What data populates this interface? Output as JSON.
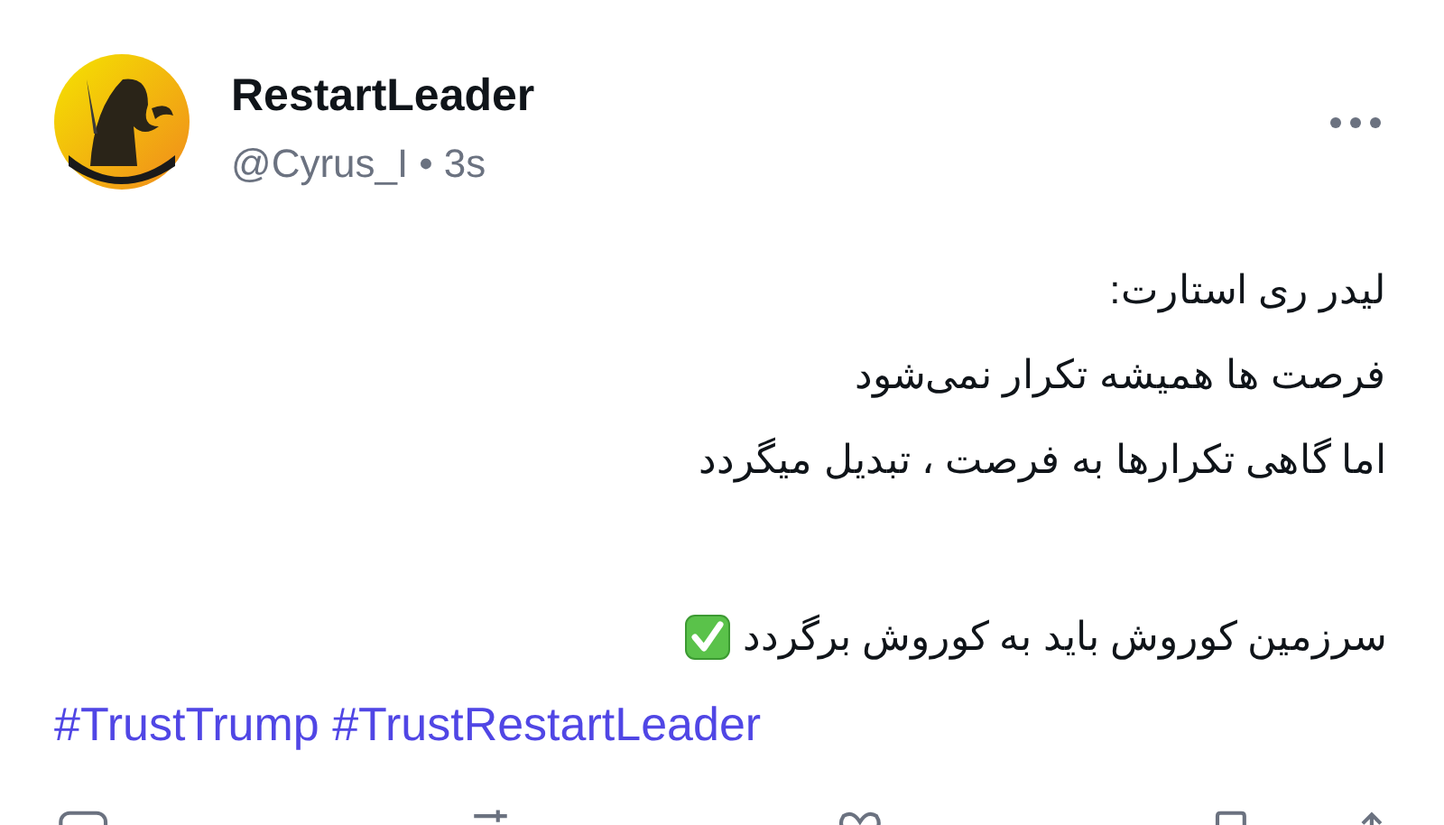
{
  "post": {
    "author": {
      "name": "RestartLeader",
      "handle": "@Cyrus_I",
      "separator": "•",
      "time": "3s"
    },
    "paragraphs": [
      [
        {
          "kind": "plain",
          "text": "لیدر ری استارت:"
        },
        {
          "kind": "plain",
          "text": "فرصت ها همیشه تکرار نمی‌شود"
        },
        {
          "kind": "plain",
          "text": "اما گاهی تکرارها به فرصت ، تبدیل میگردد"
        }
      ],
      [
        {
          "kind": "check",
          "text": "سرزمین کوروش باید به کوروش برگردد"
        }
      ]
    ],
    "hashtags": "#TrustTrump #TrustRestartLeader"
  }
}
